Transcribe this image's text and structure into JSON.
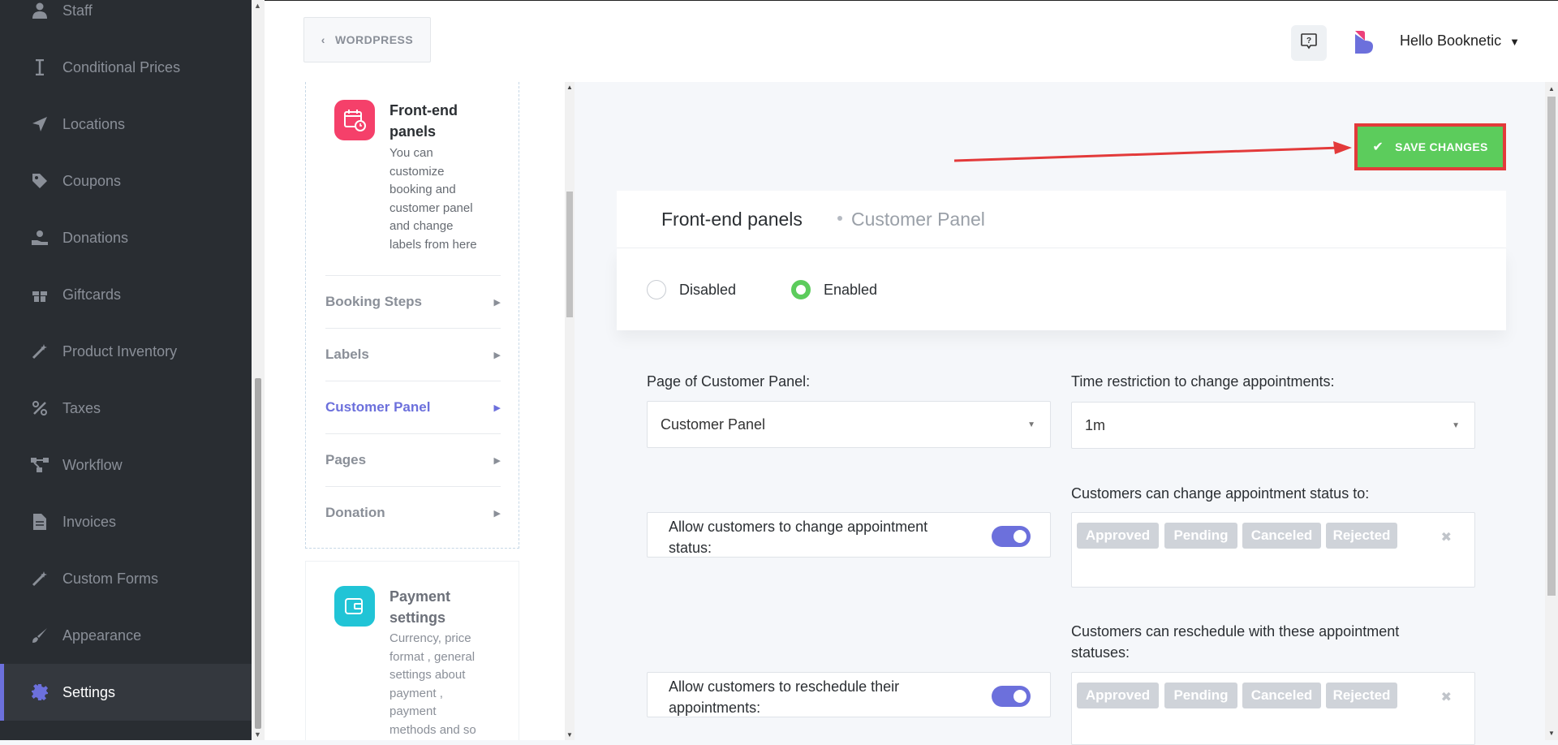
{
  "sidebar": {
    "items": [
      {
        "label": "Staff",
        "icon": "user-icon"
      },
      {
        "label": "Conditional Prices",
        "icon": "text-cursor-icon"
      },
      {
        "label": "Locations",
        "icon": "location-arrow-icon"
      },
      {
        "label": "Coupons",
        "icon": "tag-icon"
      },
      {
        "label": "Donations",
        "icon": "donation-hand-icon"
      },
      {
        "label": "Giftcards",
        "icon": "gift-icon"
      },
      {
        "label": "Product Inventory",
        "icon": "magic-wand-icon"
      },
      {
        "label": "Taxes",
        "icon": "percent-icon"
      },
      {
        "label": "Workflow",
        "icon": "workflow-icon"
      },
      {
        "label": "Invoices",
        "icon": "file-icon"
      },
      {
        "label": "Custom Forms",
        "icon": "magic-wand-icon"
      },
      {
        "label": "Appearance",
        "icon": "brush-icon"
      },
      {
        "label": "Settings",
        "icon": "gear-icon",
        "active": true
      }
    ],
    "accent": "#6c70dc"
  },
  "header": {
    "wordpress_label": "WORDPRESS",
    "greeting": "Hello Booknetic"
  },
  "settings_nav": {
    "frontend": {
      "title_line1": "Front-end",
      "title_line2": "panels",
      "desc_lines": [
        "You can",
        "customize",
        "booking and",
        "customer panel",
        "and change",
        "labels from here"
      ],
      "icon_color": "#f5406a"
    },
    "sub_items": [
      "Booking Steps",
      "Labels",
      "Customer Panel",
      "Pages",
      "Donation"
    ],
    "active_sub_item": "Customer Panel",
    "payment": {
      "title_line1": "Payment",
      "title_line2": "settings",
      "desc_lines": [
        "Currency, price",
        "format , general",
        "settings about",
        "payment ,",
        "payment",
        "methods and so"
      ],
      "icon_color": "#21c4d6"
    }
  },
  "main": {
    "save_label": "SAVE CHANGES",
    "save_color": "#5ccc5c",
    "breadcrumb_main": "Front-end panels",
    "breadcrumb_sub": "Customer Panel",
    "status_options": {
      "disabled": "Disabled",
      "enabled": "Enabled"
    },
    "status_selected": "Enabled",
    "page_label": "Page of Customer Panel:",
    "page_value": "Customer Panel",
    "time_label": "Time restriction to change appointments:",
    "time_value": "1m",
    "change_status_toggle": {
      "line1": "Allow customers to change appointment",
      "line2": "status:",
      "on": true
    },
    "change_status_to_label": "Customers can change appointment status to:",
    "change_status_tags": [
      "Approved",
      "Pending",
      "Canceled",
      "Rejected"
    ],
    "reschedule_toggle": {
      "line1": "Allow customers to reschedule their",
      "line2": "appointments:",
      "on": true
    },
    "reschedule_label_line1": "Customers can reschedule with these appointment",
    "reschedule_label_line2": "statuses:",
    "reschedule_tags": [
      "Approved",
      "Pending",
      "Canceled",
      "Rejected"
    ],
    "clear_glyph": "✖"
  }
}
